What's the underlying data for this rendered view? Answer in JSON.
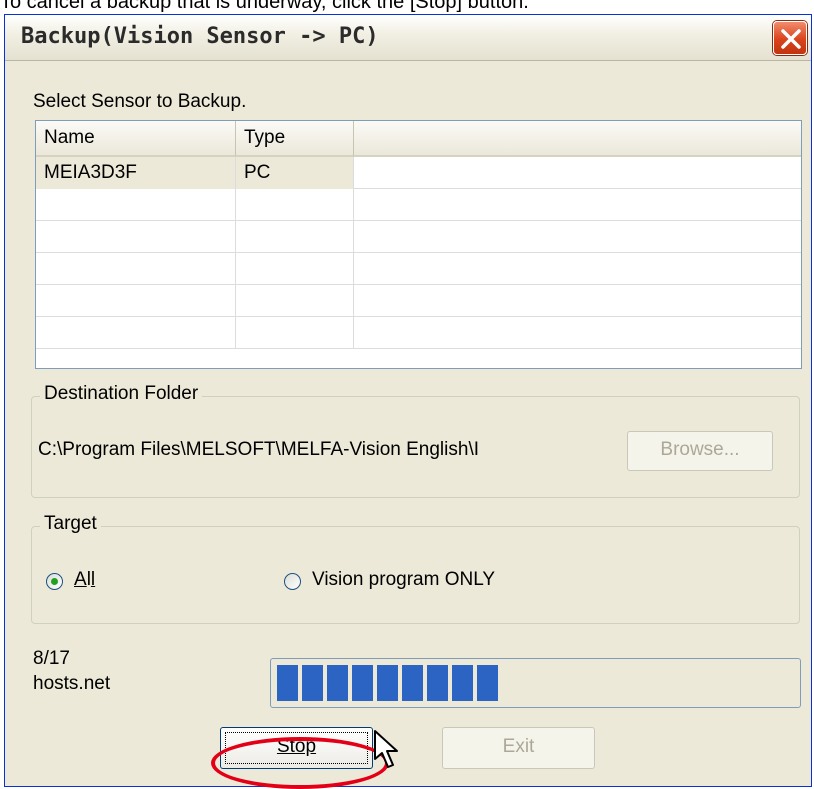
{
  "caption": "To cancel a backup that is underway, click the [Stop] button.",
  "window": {
    "title": "Backup(Vision Sensor -> PC)"
  },
  "prompt": "Select Sensor to Backup.",
  "sensor_list": {
    "columns": [
      "Name",
      "Type",
      ""
    ],
    "rows": [
      {
        "name": "MEIA3D3F",
        "type": "PC"
      },
      {
        "name": "",
        "type": ""
      },
      {
        "name": "",
        "type": ""
      },
      {
        "name": "",
        "type": ""
      },
      {
        "name": "",
        "type": ""
      },
      {
        "name": "",
        "type": ""
      }
    ]
  },
  "destination": {
    "label": "Destination Folder",
    "path": "C:\\Program Files\\MELSOFT\\MELFA-Vision English\\I",
    "browse_label": "Browse..."
  },
  "target": {
    "label": "Target",
    "options": [
      {
        "label": "All",
        "selected": true
      },
      {
        "label": "Vision program ONLY",
        "selected": false
      }
    ]
  },
  "progress": {
    "count": "8/17",
    "file": "hosts.net",
    "fraction": 0.47
  },
  "buttons": {
    "stop": "Stop",
    "exit": "Exit"
  },
  "colors": {
    "progress": "#2c64c4",
    "highlight": "#e30016"
  }
}
